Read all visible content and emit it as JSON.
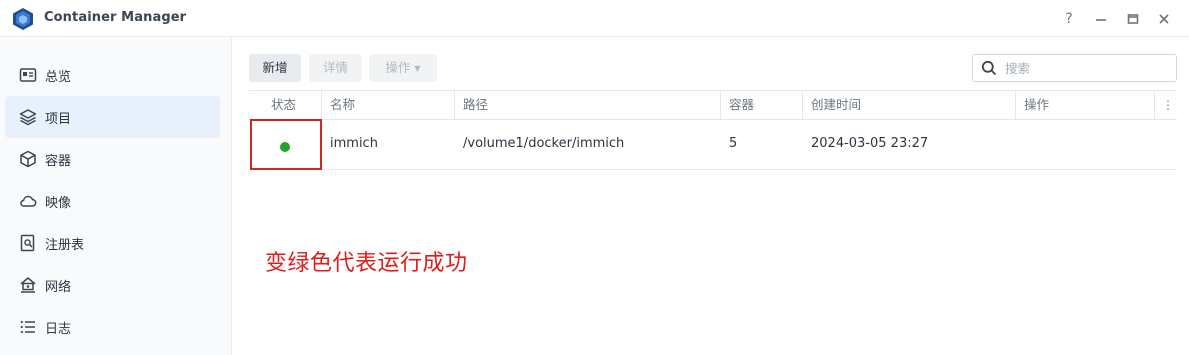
{
  "window": {
    "title": "Container Manager",
    "controls": [
      "help-icon",
      "minimize-icon",
      "maximize-icon",
      "close-icon"
    ],
    "help_label": "?"
  },
  "sidebar": {
    "items": [
      {
        "label": "总览",
        "icon": "overview-icon",
        "active": false
      },
      {
        "label": "项目",
        "icon": "layers-icon",
        "active": true
      },
      {
        "label": "容器",
        "icon": "cube-icon",
        "active": false
      },
      {
        "label": "映像",
        "icon": "cloud-icon",
        "active": false
      },
      {
        "label": "注册表",
        "icon": "registry-icon",
        "active": false
      },
      {
        "label": "网络",
        "icon": "network-icon",
        "active": false
      },
      {
        "label": "日志",
        "icon": "list-icon",
        "active": false
      }
    ]
  },
  "toolbar": {
    "create_label": "新增",
    "details_label": "详情",
    "actions_label": "操作",
    "search_placeholder": "搜索"
  },
  "table": {
    "columns": [
      "状态",
      "名称",
      "路径",
      "容器",
      "创建时间",
      "操作"
    ],
    "rows": [
      {
        "status": "running",
        "status_color": "#1fa22e",
        "name": "immich",
        "path": "/volume1/docker/immich",
        "containers": "5",
        "created": "2024-03-05 23:27",
        "actions": ""
      }
    ]
  },
  "annotation": {
    "text": "变绿色代表运行成功",
    "color": "#e11b1b"
  },
  "colors": {
    "accent_active_bg": "#e8f0fb",
    "status_running": "#1fa22e",
    "annotation_red": "#d42525"
  }
}
